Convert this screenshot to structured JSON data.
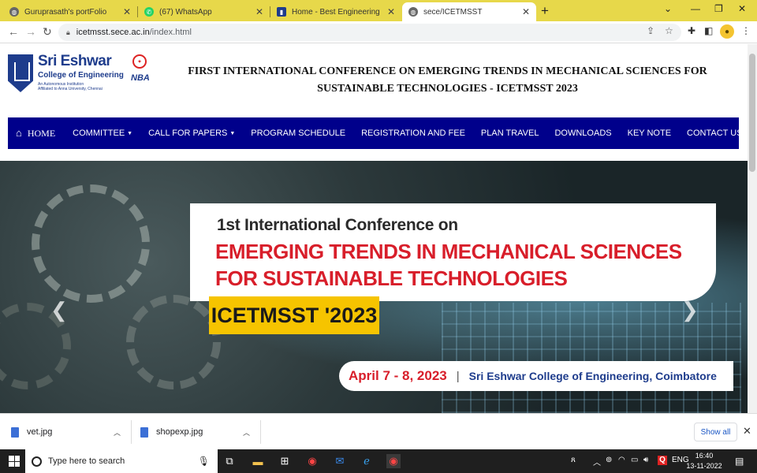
{
  "browser": {
    "tabs": [
      {
        "title": "Guruprasath's portFolio",
        "active": false
      },
      {
        "title": "(67) WhatsApp",
        "active": false
      },
      {
        "title": "Home - Best Engineering College in Coimbatore",
        "active": false
      },
      {
        "title": "sece/ICETMSST",
        "active": true
      }
    ],
    "address": {
      "host": "icetmsst.sece.ac.in",
      "path": "/index.html"
    }
  },
  "header": {
    "logo": {
      "brand": "Sri Eshwar",
      "subtitle": "College of Engineering",
      "tagline1": "An Autonomous Institution",
      "tagline2": "Affiliated to Anna University, Chennai",
      "accreditation": "NBA"
    },
    "title": "FIRST INTERNATIONAL CONFERENCE ON EMERGING TRENDS IN MECHANICAL SCIENCES FOR SUSTAINABLE TECHNOLOGIES - ICETMSST 2023"
  },
  "nav": {
    "items": [
      {
        "label": "HOME",
        "dropdown": false
      },
      {
        "label": "COMMITTEE",
        "dropdown": true
      },
      {
        "label": "CALL FOR PAPERS",
        "dropdown": true
      },
      {
        "label": "PROGRAM SCHEDULE",
        "dropdown": false
      },
      {
        "label": "REGISTRATION AND FEE",
        "dropdown": false
      },
      {
        "label": "PLAN TRAVEL",
        "dropdown": false
      },
      {
        "label": "DOWNLOADS",
        "dropdown": false
      },
      {
        "label": "KEY NOTE",
        "dropdown": false
      },
      {
        "label": "CONTACT US",
        "dropdown": false
      }
    ],
    "background": "#00008b"
  },
  "hero": {
    "line1": "1st International Conference on",
    "line2": "EMERGING TRENDS IN MECHANICAL SCIENCES",
    "line3": "FOR SUSTAINABLE TECHNOLOGIES",
    "acronym": "ICETMSST '2023",
    "date": "April 7 - 8, 2023",
    "venue": "Sri Eshwar College of Engineering, Coimbatore",
    "accent_red": "#d81e2a",
    "accent_yellow": "#f6c400"
  },
  "downloads": {
    "items": [
      {
        "filename": "vet.jpg"
      },
      {
        "filename": "shopexp.jpg"
      }
    ],
    "show_all": "Show all"
  },
  "taskbar": {
    "search_placeholder": "Type here to search",
    "language": "ENG",
    "time": "16:40",
    "date": "13-11-2022"
  }
}
